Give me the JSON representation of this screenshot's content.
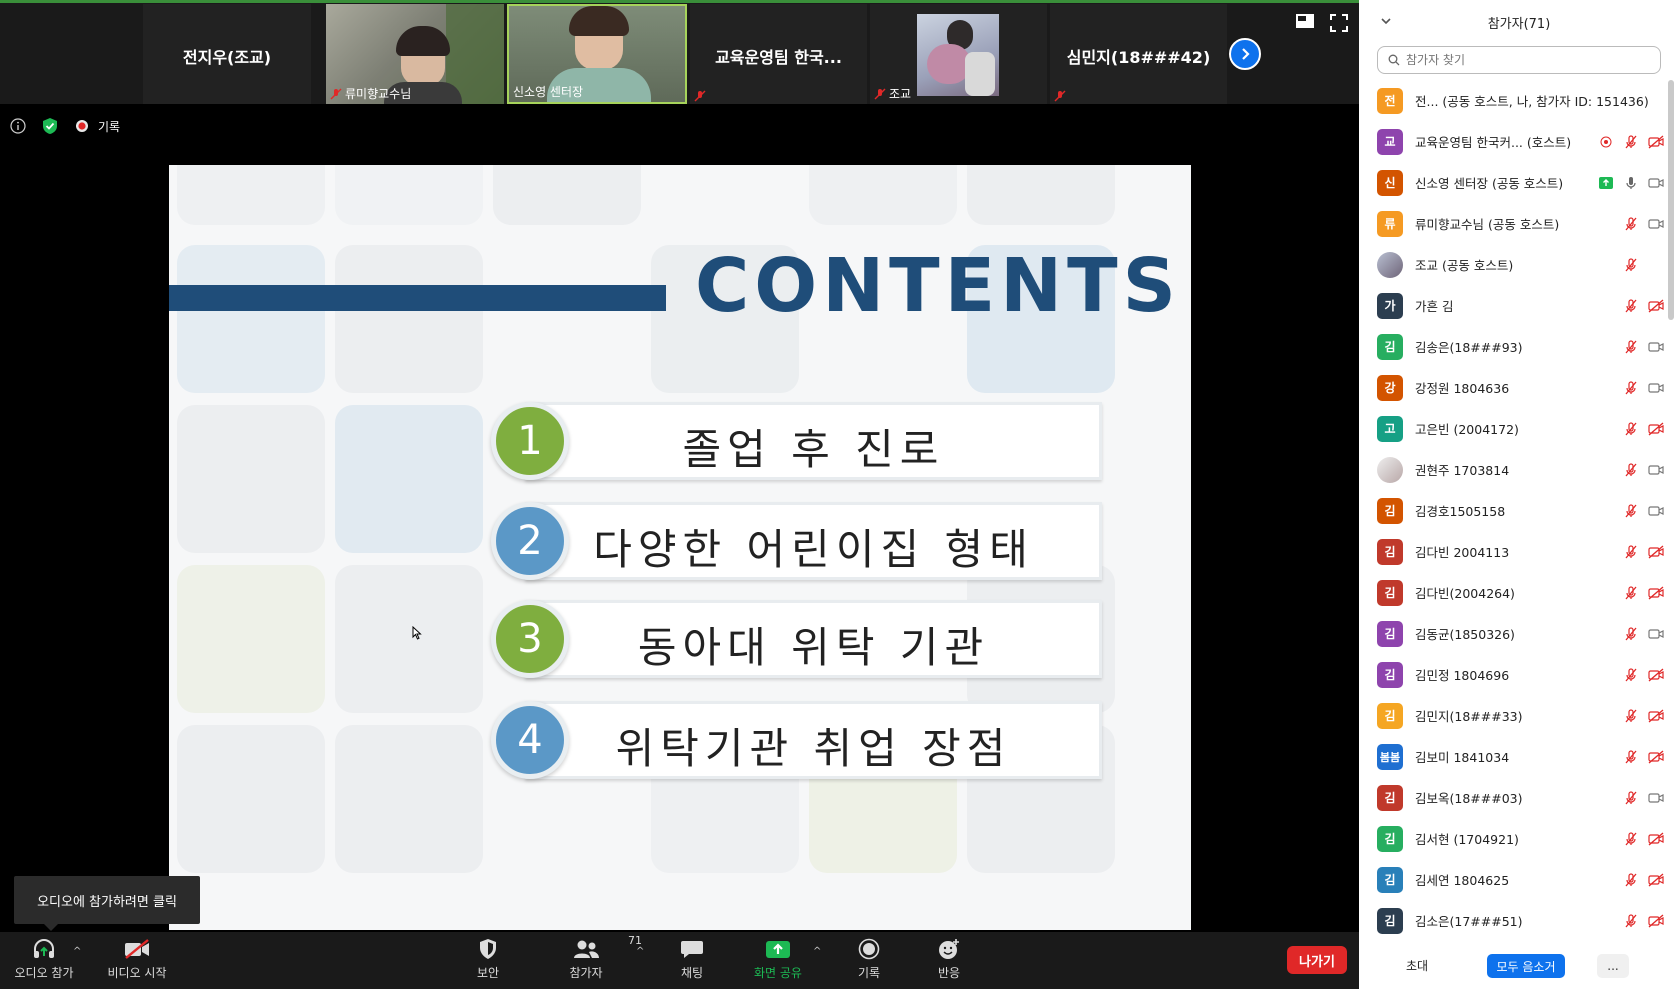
{
  "gallery": {
    "tiles": [
      {
        "name": "전지우(조교)",
        "type": "name"
      },
      {
        "name": "류미향교수님",
        "type": "video"
      },
      {
        "name": "신소영 센터장",
        "type": "video"
      },
      {
        "name": "교육운영팀 한국...",
        "type": "name"
      },
      {
        "name": "조교",
        "type": "video"
      },
      {
        "name": "심민지(18###42)",
        "type": "name"
      }
    ]
  },
  "infobar": {
    "record_label": "기록"
  },
  "slide": {
    "title": "CONTENTS",
    "items": [
      {
        "num": "1",
        "text": "졸업 후 진로",
        "color": "#7fae3f"
      },
      {
        "num": "2",
        "text": "다양한 어린이집 형태",
        "color": "#5b98c7"
      },
      {
        "num": "3",
        "text": "동아대 위탁 기관",
        "color": "#7fae3f"
      },
      {
        "num": "4",
        "text": "위탁기관 취업 장점",
        "color": "#5b98c7"
      }
    ]
  },
  "tooltip": "오디오에 참가하려면 클릭",
  "toolbar": {
    "audio": "오디오 참가",
    "video": "비디오 시작",
    "security": "보안",
    "participants": "참가자",
    "participants_count": "71",
    "chat": "채팅",
    "share": "화면 공유",
    "record": "기록",
    "reactions": "반응",
    "leave": "나가기"
  },
  "panel": {
    "title": "참가자(71)",
    "search_placeholder": "참가자 찾기",
    "participants": [
      {
        "avatar": "전",
        "color": "#f59a23",
        "name": "전...  (공동 호스트, 나, 참가자 ID: 151436)",
        "mic": "none",
        "cam": "none"
      },
      {
        "avatar": "교",
        "color": "#8e44ad",
        "name": "교육운영팀 한국커...  (호스트)",
        "mic": "muted",
        "cam": "off",
        "rec": true
      },
      {
        "avatar": "신",
        "color": "#d35400",
        "name": "신소영 센터장 (공동 호스트)",
        "mic": "on",
        "cam": "on",
        "share": true
      },
      {
        "avatar": "류",
        "color": "#f59a23",
        "name": "류미향교수님 (공동 호스트)",
        "mic": "muted",
        "cam": "on"
      },
      {
        "avatar": "photo",
        "color": "#888888",
        "name": "조교 (공동 호스트)",
        "mic": "muted",
        "cam": "none"
      },
      {
        "avatar": "가",
        "color": "#2c3e50",
        "name": "가흔 김",
        "mic": "muted",
        "cam": "off"
      },
      {
        "avatar": "김",
        "color": "#27ae60",
        "name": "김송은(18###93)",
        "mic": "muted",
        "cam": "on"
      },
      {
        "avatar": "강",
        "color": "#d35400",
        "name": "강정원 1804636",
        "mic": "muted",
        "cam": "on"
      },
      {
        "avatar": "고",
        "color": "#16a085",
        "name": "고은빈 (2004172)",
        "mic": "muted",
        "cam": "off"
      },
      {
        "avatar": "photo2",
        "color": "#999999",
        "name": "권현주 1703814",
        "mic": "muted",
        "cam": "on"
      },
      {
        "avatar": "김",
        "color": "#d35400",
        "name": "김경호1505158",
        "mic": "muted",
        "cam": "on"
      },
      {
        "avatar": "김",
        "color": "#c0392b",
        "name": "김다빈 2004113",
        "mic": "muted",
        "cam": "off"
      },
      {
        "avatar": "김",
        "color": "#c0392b",
        "name": "김다빈(2004264)",
        "mic": "muted",
        "cam": "off"
      },
      {
        "avatar": "김",
        "color": "#8e44ad",
        "name": "김동균(1850326)",
        "mic": "muted",
        "cam": "on"
      },
      {
        "avatar": "김",
        "color": "#8e44ad",
        "name": "김민정 1804696",
        "mic": "muted",
        "cam": "off"
      },
      {
        "avatar": "김",
        "color": "#f5a623",
        "name": "김민지(18###33)",
        "mic": "muted",
        "cam": "off"
      },
      {
        "avatar": "봄봄",
        "color": "#1f6fd1",
        "name": "김보미 1841034",
        "mic": "muted",
        "cam": "off"
      },
      {
        "avatar": "김",
        "color": "#c0392b",
        "name": "김보옥(18###03)",
        "mic": "muted",
        "cam": "on"
      },
      {
        "avatar": "김",
        "color": "#27ae60",
        "name": "김서현 (1704921)",
        "mic": "muted",
        "cam": "off"
      },
      {
        "avatar": "김",
        "color": "#2980b9",
        "name": "김세연 1804625",
        "mic": "muted",
        "cam": "off"
      },
      {
        "avatar": "김",
        "color": "#2c3e50",
        "name": "김소은(17###51)",
        "mic": "muted",
        "cam": "off"
      }
    ],
    "invite": "초대",
    "mute_all": "모두 음소거",
    "more": "..."
  }
}
